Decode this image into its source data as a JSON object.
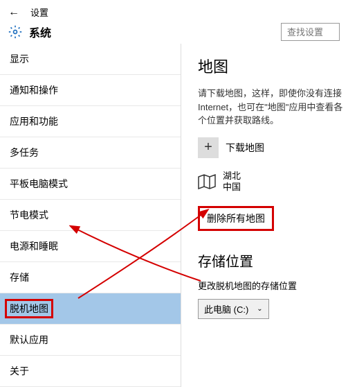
{
  "header": {
    "breadcrumb": "设置",
    "title": "系统",
    "search_placeholder": "查找设置"
  },
  "sidebar": {
    "items": [
      {
        "label": "显示"
      },
      {
        "label": "通知和操作"
      },
      {
        "label": "应用和功能"
      },
      {
        "label": "多任务"
      },
      {
        "label": "平板电脑模式"
      },
      {
        "label": "节电模式"
      },
      {
        "label": "电源和睡眠"
      },
      {
        "label": "存储"
      },
      {
        "label": "脱机地图"
      },
      {
        "label": "默认应用"
      },
      {
        "label": "关于"
      }
    ]
  },
  "main": {
    "heading": "地图",
    "description": "请下载地图，这样，即使你没有连接 Internet，也可在\"地图\"应用中查看各个位置并获取路线。",
    "download_label": "下载地图",
    "location": {
      "region": "湖北",
      "country": "中国"
    },
    "delete_label": "删除所有地图",
    "storage": {
      "title": "存储位置",
      "desc": "更改脱机地图的存储位置",
      "value": "此电脑 (C:)"
    },
    "icons": {
      "back": "back-arrow-icon",
      "gear": "gear-icon",
      "plus": "plus-icon",
      "map": "map-fold-icon",
      "chevron": "chevron-down-icon"
    }
  }
}
